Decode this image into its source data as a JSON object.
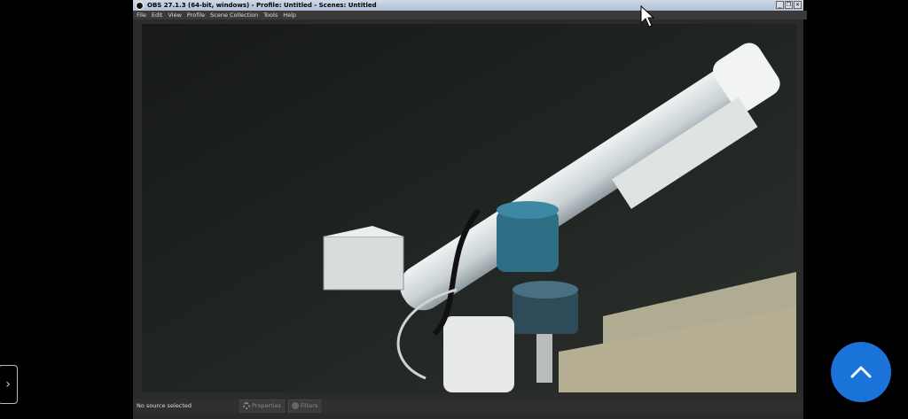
{
  "window": {
    "title": "OBS 27.1.3 (64-bit, windows) - Profile: Untitled - Scenes: Untitled",
    "controls": [
      "_",
      "❐",
      "✕"
    ]
  },
  "menu": [
    "File",
    "Edit",
    "View",
    "Profile",
    "Scene Collection",
    "Tools",
    "Help"
  ],
  "status": {
    "source": "No source selected",
    "properties_label": "Properties",
    "filters_label": "Filters"
  },
  "preview": {
    "description_icon": "telescope-camera-feed"
  },
  "overlay": {
    "side_arrow": "›",
    "fab_icon": "chevron-up-icon",
    "accent": "#1a73d9"
  }
}
